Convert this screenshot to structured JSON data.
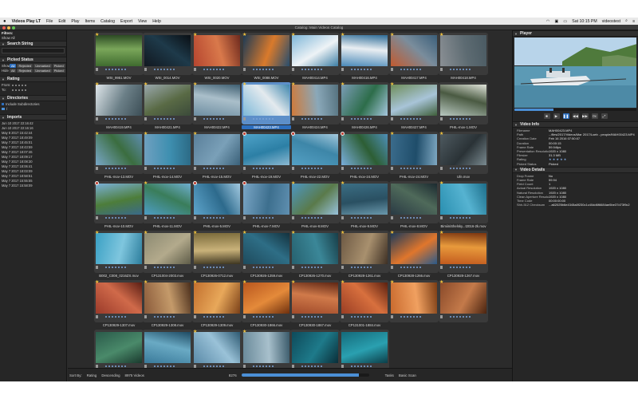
{
  "menubar": {
    "app_name": "Videos Play LT",
    "items": [
      "File",
      "Edit",
      "Play",
      "Items",
      "Catalog",
      "Export",
      "View",
      "Help"
    ],
    "clock": "Sat 10:15 PM",
    "user": "videostest"
  },
  "window": {
    "title": "Catalog: Main Videos Catalog"
  },
  "sidebar": {
    "filters_label": "Filters:",
    "show_all": "Show All",
    "search_section": "Search String",
    "picked_section": "Picked Status",
    "show_label": "Show",
    "hide_label": "Hide",
    "pills": [
      "All",
      "Rejected",
      "Unmarked",
      "Picked"
    ],
    "rating_section": "Rating",
    "from_label": "From:",
    "to_label": "To:",
    "directories_section": "Directories",
    "include_sub": "Include Subdirectories",
    "dir_item": "/",
    "imports_section": "Imports",
    "imports": [
      "Jun 10 2017 22:16:42",
      "Jun 10 2017 22:16:16",
      "May 8 2017 15:42:44",
      "May 7 2017 18:49:09",
      "May 7 2017 18:45:01",
      "May 7 2017 18:43:59",
      "May 7 2017 18:07:46",
      "May 7 2017 18:09:17",
      "May 7 2017 18:08:30",
      "May 7 2017 18:06:41",
      "May 7 2017 18:03:09",
      "May 7 2017 18:58:51",
      "May 7 2017 15:55:55",
      "May 7 2017 15:58:09"
    ]
  },
  "grid": {
    "items": [
      {
        "name": "WSI_9951.MOV",
        "badge": "star"
      },
      {
        "name": "WSI_0014.MOV",
        "badge": "none"
      },
      {
        "name": "WSI_0020.MOV",
        "badge": "star"
      },
      {
        "name": "WSI_0088.MOV",
        "badge": "star"
      },
      {
        "name": "MAH00414.MP4",
        "badge": "star"
      },
      {
        "name": "MAH00416.MP4",
        "badge": "star"
      },
      {
        "name": "MAH00417.MP4",
        "badge": "star"
      },
      {
        "name": "MAH00418.MP4",
        "badge": "star"
      },
      {
        "name": "MAH00419.MP4",
        "badge": "star"
      },
      {
        "name": "MAH00421.MP4",
        "badge": "star"
      },
      {
        "name": "MAH00422.MP4",
        "badge": "star"
      },
      {
        "name": "MAH00423.MP4",
        "badge": "star",
        "selected": true
      },
      {
        "name": "MAH00424.MP4",
        "badge": "star"
      },
      {
        "name": "MAH00426.MP4",
        "badge": "star"
      },
      {
        "name": "MAH00427.MP4",
        "badge": "star"
      },
      {
        "name": "PHIL-mov-1.MOV",
        "badge": "none"
      },
      {
        "name": "PHIL-mov-13.MOV",
        "badge": "star"
      },
      {
        "name": "PHIL-mov-14.MOV",
        "badge": "star"
      },
      {
        "name": "PHIL-mov-15.MOV",
        "badge": "star"
      },
      {
        "name": "PHIL-mov-19.MOV",
        "badge": "reject"
      },
      {
        "name": "PHIL-mov-22.MOV",
        "badge": "reject"
      },
      {
        "name": "PHIL-mov-24.MOV",
        "badge": "reject"
      },
      {
        "name": "PHIL-mov-24.MOV",
        "badge": "star"
      },
      {
        "name": "Ufe.mov",
        "badge": "star"
      },
      {
        "name": "PHIL-mov-10.MOV",
        "badge": "reject"
      },
      {
        "name": "PHIL-mov-11.MOV",
        "badge": "star"
      },
      {
        "name": "PHIL-mov-5.MOV",
        "badge": "reject"
      },
      {
        "name": "PHIL-mov-7.MOV",
        "badge": "reject"
      },
      {
        "name": "PHIL-mov-8.MOV",
        "badge": "star"
      },
      {
        "name": "PHIL-mov-9.MOV",
        "badge": "star"
      },
      {
        "name": "PHIL-mov-8.MOV",
        "badge": "none"
      },
      {
        "name": "BimiiniShelsky...t2016-2k.mov",
        "badge": "star"
      },
      {
        "name": "B002_C008_0216ZX.mov",
        "badge": "star"
      },
      {
        "name": "CP131004-2003.mov",
        "badge": "star"
      },
      {
        "name": "CP130926-0712.mov",
        "badge": "star"
      },
      {
        "name": "CP130926-1259.mov",
        "badge": "star"
      },
      {
        "name": "CP130926-1270.mov",
        "badge": "star"
      },
      {
        "name": "CP130928-1261.mov",
        "badge": "star"
      },
      {
        "name": "CP130928-1266.mov",
        "badge": "star"
      },
      {
        "name": "CP130928-1267.mov",
        "badge": "star"
      },
      {
        "name": "CP130929-1307.mov",
        "badge": "star"
      },
      {
        "name": "CP130929-1308.mov",
        "badge": "star"
      },
      {
        "name": "CP130929-1309.mov",
        "badge": "star"
      },
      {
        "name": "CP130930-1866.mov",
        "badge": "star"
      },
      {
        "name": "CP130930-1867.mov",
        "badge": "star"
      },
      {
        "name": "CP131001-1884.mov",
        "badge": "star"
      },
      {
        "name": "",
        "badge": "star"
      },
      {
        "name": "",
        "badge": "star"
      },
      {
        "name": "",
        "badge": "none"
      },
      {
        "name": "",
        "badge": "none"
      },
      {
        "name": "",
        "badge": "star"
      },
      {
        "name": "",
        "badge": "star"
      },
      {
        "name": "",
        "badge": "none"
      },
      {
        "name": "",
        "badge": "none"
      }
    ]
  },
  "bottombar": {
    "sort_by": "Sort By:",
    "rating": "Rating",
    "order": "Descending",
    "count": "8975 Videos",
    "progress_label": "8276",
    "progress_fraction": 0.92,
    "tasks": "Tasks",
    "basic_scan": "Basic Scan"
  },
  "player": {
    "section": "Player",
    "scrub_fraction": 0.32,
    "buttons": [
      "■",
      "▶",
      "❚❚",
      "◀◀",
      "▶▶",
      "0x",
      "⤢"
    ]
  },
  "video_info": {
    "section": "Video Info",
    "rows": [
      {
        "k": "Filename",
        "v": "MAH00423.MP4"
      },
      {
        "k": "Path",
        "v": "...files/2017/Videos/Mar 2017/Loeb - people/MAH00423.MP4"
      },
      {
        "k": "Creation Date",
        "v": "Feb 16 2016 07:50:07"
      },
      {
        "k": "Duration",
        "v": "00:00:15"
      },
      {
        "k": "Frame Rate",
        "v": "59.94fps"
      },
      {
        "k": "Presentation Resolution",
        "v": "1920 x 1080"
      },
      {
        "k": "Filesize",
        "v": "31.3 MB"
      },
      {
        "k": "Rating",
        "v": "★ ★ ★ ★ ★"
      },
      {
        "k": "Picked Status",
        "v": "Picked"
      }
    ]
  },
  "video_details": {
    "section": "Video Details",
    "rows": [
      {
        "k": "Drop Frame",
        "v": "No"
      },
      {
        "k": "Frame Rate",
        "v": "59.94"
      },
      {
        "k": "Field Count",
        "v": "1"
      },
      {
        "k": "Actual Resolution",
        "v": "1920 x 1080"
      },
      {
        "k": "Natural Resolution",
        "v": "1920 x 1080"
      },
      {
        "k": "Clean Aperture Resolution",
        "v": "1920 x 1080"
      },
      {
        "k": "Time Code",
        "v": "00:00:00:00"
      },
      {
        "k": "Shh-512 Checksum",
        "v": "...a62025b6e4345a8f230c1c40dd6f6684ae5be37d73f9c2"
      }
    ]
  },
  "colors": {
    "accent": "#2d6fbf",
    "star": "#f3c43c",
    "reject": "#c0392b",
    "panel": "#262626"
  }
}
